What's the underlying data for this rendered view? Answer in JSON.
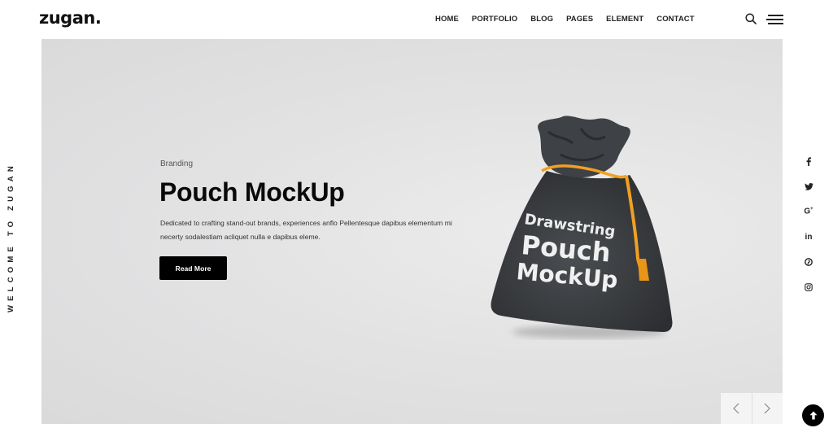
{
  "header": {
    "logo": "zugan.",
    "nav": [
      {
        "label": "HOME"
      },
      {
        "label": "PORTFOLIO"
      },
      {
        "label": "BLOG"
      },
      {
        "label": "PAGES"
      },
      {
        "label": "ELEMENT"
      },
      {
        "label": "CONTACT"
      }
    ],
    "icons": {
      "search": "search-icon",
      "menu": "hamburger-menu-icon"
    }
  },
  "sidebar": {
    "vertical_text": "WELCOME TO ZUGAN"
  },
  "hero": {
    "category": "Branding",
    "title": "Pouch MockUp",
    "description": "Dedicated to crafting stand-out brands, experiences anflo Pellentesque dapibus elementum mi necerty sodalestiam acliquet nulla e dapibus eleme.",
    "button_label": "Read More",
    "image": {
      "subject": "drawstring-pouch",
      "print_line1": "Drawstring",
      "print_line2": "Pouch",
      "print_line3": "MockUp",
      "bag_color": "#3a3d40",
      "cord_color": "#f0a023"
    }
  },
  "social": [
    {
      "name": "facebook",
      "glyph": "f"
    },
    {
      "name": "twitter",
      "glyph": "t"
    },
    {
      "name": "google-plus",
      "glyph": "G+"
    },
    {
      "name": "linkedin",
      "glyph": "in"
    },
    {
      "name": "pinterest",
      "glyph": "p"
    },
    {
      "name": "instagram",
      "glyph": "ig"
    }
  ],
  "slider": {
    "prev": "chevron-left-icon",
    "next": "chevron-right-icon"
  },
  "scroll_top": "arrow-up-icon"
}
